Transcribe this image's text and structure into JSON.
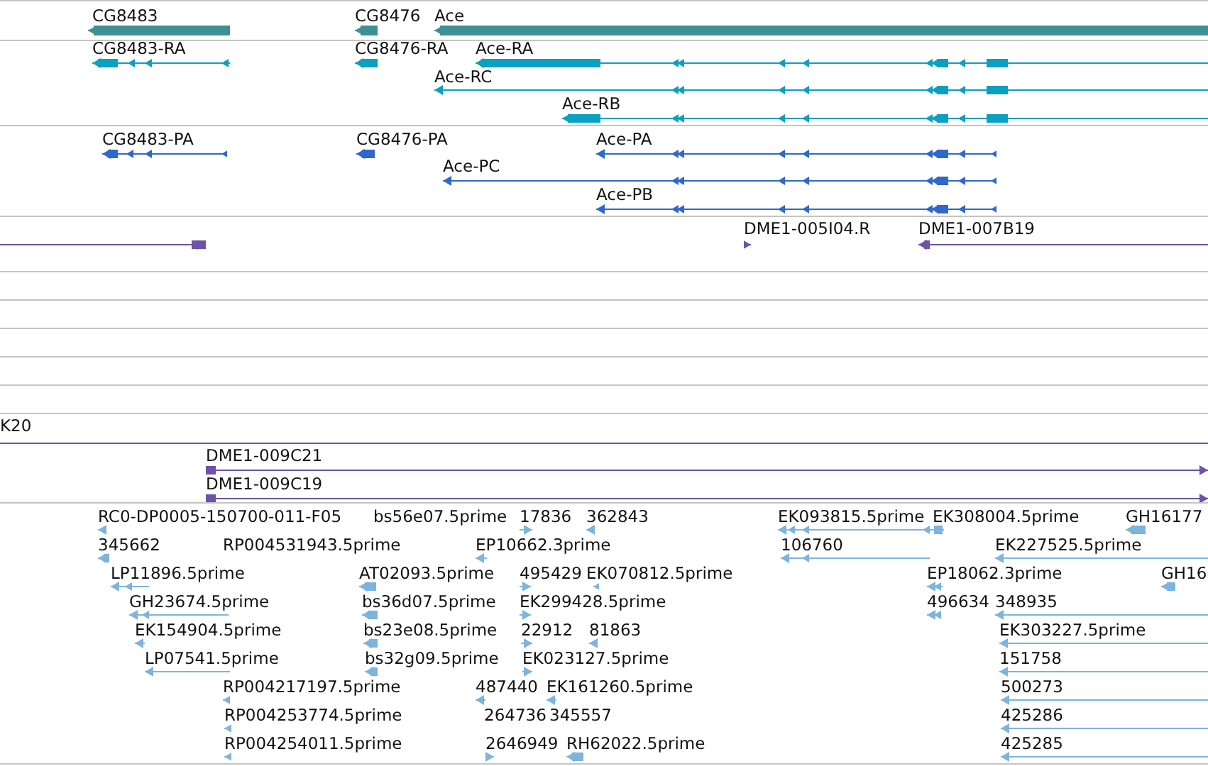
{
  "tracks": [
    {
      "color": "#3e9096",
      "features": [
        {
          "label": "CG8483",
          "reverse": true
        },
        {
          "label": "CG8476",
          "reverse": true
        },
        {
          "label": "Ace",
          "reverse": true
        }
      ]
    },
    {
      "color": "#0aa0c2",
      "features": [
        {
          "label": "CG8483-RA",
          "reverse": true
        },
        {
          "label": "CG8476-RA",
          "reverse": true
        },
        {
          "label": "Ace-RA",
          "reverse": true
        },
        {
          "label": "Ace-RC",
          "reverse": true
        },
        {
          "label": "Ace-RB",
          "reverse": true
        }
      ]
    },
    {
      "color": "#2f68cc",
      "features": [
        {
          "label": "CG8483-PA",
          "reverse": true
        },
        {
          "label": "CG8476-PA",
          "reverse": true
        },
        {
          "label": "Ace-PA",
          "reverse": true
        },
        {
          "label": "Ace-PC",
          "reverse": true
        },
        {
          "label": "Ace-PB",
          "reverse": true
        }
      ]
    },
    {
      "color": "#6e52a8",
      "features": [
        {
          "reverse": false
        },
        {
          "label": "DME1-005I04.R",
          "reverse": false
        },
        {
          "label": "DME1-007B19",
          "reverse": true
        }
      ]
    },
    {
      "color": "#6e52a8",
      "features": [
        {
          "label": "K20"
        },
        {
          "label": "DME1-009C21",
          "reverse": false
        },
        {
          "label": "DME1-009C19",
          "reverse": false
        }
      ]
    },
    {
      "color": "#7cb4de",
      "features": [
        {
          "label": "RC0-DP0005-150700-011-F05",
          "reverse": true
        },
        {
          "label": "bs56e07.5prime"
        },
        {
          "label": "17836",
          "reverse": false
        },
        {
          "label": "362843",
          "reverse": true
        },
        {
          "label": "EK093815.5prime",
          "reverse": true
        },
        {
          "label": "EK308004.5prime",
          "reverse": true
        },
        {
          "label": "GH16177",
          "reverse": true
        },
        {
          "label": "345662",
          "reverse": true
        },
        {
          "label": "RP004531943.5prime"
        },
        {
          "label": "EP10662.3prime",
          "reverse": true
        },
        {
          "label": "106760",
          "reverse": true
        },
        {
          "label": "EK227525.5prime",
          "reverse": true
        },
        {
          "label": "LP11896.5prime",
          "reverse": true
        },
        {
          "label": "AT02093.5prime",
          "reverse": true
        },
        {
          "label": "495429",
          "reverse": false
        },
        {
          "label": "EK070812.5prime",
          "reverse": true
        },
        {
          "label": "EP18062.3prime",
          "reverse": true
        },
        {
          "label": "GH16",
          "reverse": true
        },
        {
          "label": "GH23674.5prime",
          "reverse": true
        },
        {
          "label": "bs36d07.5prime",
          "reverse": true
        },
        {
          "label": "EK299428.5prime",
          "reverse": false
        },
        {
          "label": "496634",
          "reverse": true
        },
        {
          "label": "348935",
          "reverse": true
        },
        {
          "label": "EK154904.5prime",
          "reverse": true
        },
        {
          "label": "bs23e08.5prime",
          "reverse": true
        },
        {
          "label": "22912",
          "reverse": false
        },
        {
          "label": "81863",
          "reverse": true
        },
        {
          "label": "EK303227.5prime",
          "reverse": true
        },
        {
          "label": "LP07541.5prime",
          "reverse": true
        },
        {
          "label": "bs32g09.5prime",
          "reverse": true
        },
        {
          "label": "EK023127.5prime",
          "reverse": false
        },
        {
          "label": "151758",
          "reverse": true
        },
        {
          "label": "RP004217197.5prime",
          "reverse": true
        },
        {
          "label": "487440",
          "reverse": true
        },
        {
          "label": "EK161260.5prime",
          "reverse": true
        },
        {
          "label": "500273",
          "reverse": true
        },
        {
          "label": "RP004253774.5prime",
          "reverse": true
        },
        {
          "label": "264736"
        },
        {
          "label": "345557"
        },
        {
          "label": "425286",
          "reverse": true
        },
        {
          "label": "RP004254011.5prime",
          "reverse": true
        },
        {
          "label": "2646949",
          "reverse": false
        },
        {
          "label": "RH62022.5prime",
          "reverse": true
        },
        {
          "label": "425285",
          "reverse": true
        }
      ]
    }
  ]
}
